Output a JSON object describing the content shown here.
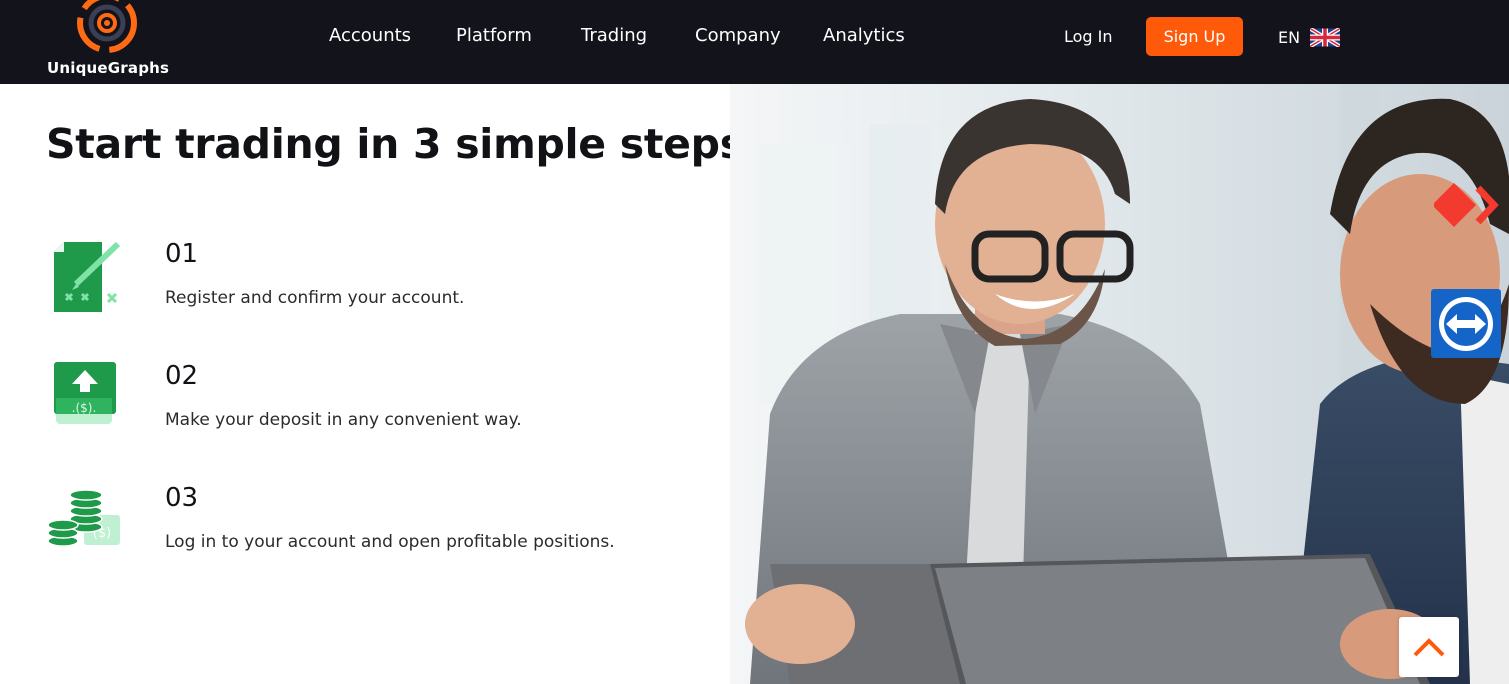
{
  "header": {
    "brand_name": "UniqueGraphs",
    "nav": [
      {
        "label": "Accounts"
      },
      {
        "label": "Platform"
      },
      {
        "label": "Trading"
      },
      {
        "label": "Company"
      },
      {
        "label": "Analytics"
      }
    ],
    "login_label": "Log In",
    "signup_label": "Sign Up",
    "language_code": "EN"
  },
  "main": {
    "headline": "Start trading in 3 simple steps",
    "steps": [
      {
        "number": "01",
        "text": "Register and confirm your account.",
        "icon": "document-pen-icon"
      },
      {
        "number": "02",
        "text": "Make your deposit in any convenient way.",
        "icon": "deposit-upload-icon"
      },
      {
        "number": "03",
        "text": "Log in to your account and open profitable positions.",
        "icon": "coins-stack-icon"
      }
    ]
  },
  "widgets": {
    "pin_icon": "red-diamond-chevron-icon",
    "remote_icon": "teamviewer-arrows-icon",
    "scroll_icon": "chevron-up-icon"
  },
  "colors": {
    "header_bg": "#12131b",
    "accent": "#ff5a0a",
    "step_green": "#1f9a4b",
    "step_green_light": "#7fe2a6",
    "remote_blue": "#1565c8"
  }
}
